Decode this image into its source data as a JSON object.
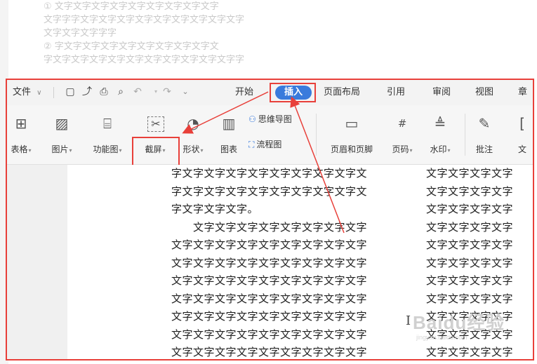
{
  "background_doc": {
    "lines": [
      "① 文字文字文字文字文字文字文字文字文字",
      "文字字字文字文字文字文字文字文字文字文字文字",
      "文字文字文字字字",
      "② 字文字文字文字文字文字文字文字文字文",
      "字文字文字文字文字文字文字文字文字文字文字字"
    ]
  },
  "menubar": {
    "file": "文件",
    "tabs": [
      "开始",
      "插入",
      "页面布局",
      "引用",
      "审阅",
      "视图",
      "章"
    ]
  },
  "ribbon": {
    "table": "表格",
    "picture": "图片",
    "function_chart": "功能图",
    "screenshot": "截屏",
    "shape": "形状",
    "chart": "图表",
    "mindmap": "思维导图",
    "flowchart": "流程图",
    "header_footer": "页眉和页脚",
    "page_number": "页码",
    "watermark": "水印",
    "comment": "批注",
    "text": "文"
  },
  "document": {
    "column1": [
      "字文字文字文字文字文字文字文字文字文",
      "字文字文字文字文字文字文字文字文字文",
      "字文字文字文字。",
      "　　文字文字文字文字文字文字文字文字",
      "文字文字文字文字文字文字文字文字文字",
      "文字文字文字文字文字文字文字文字文字",
      "文字文字文字文字文字文字文字文字文字",
      "文字文字文字文字文字文字文字文字文字",
      "文字文字文字文字文字文字文字文字文字",
      "文字文字文字文字文字文字文字文字文字",
      "文字文字文字文字文字文字文字文字文字"
    ],
    "column2": [
      "文字文字文字文字",
      "文字文字文字文字",
      "文字文字文字文字",
      "文字文字文字文字",
      "文字文字文字文字",
      "文字文字文字文字",
      "文字文字文字文字",
      "文字文字文字文字",
      "文字文字文字文字",
      "文字文字文字文字",
      "文字文字文字文字"
    ]
  },
  "watermark": {
    "brand": "Baidu经验",
    "url": "jingyan.baidu.com"
  },
  "colors": {
    "highlight_red": "#e8403a",
    "active_tab_blue": "#3a7bdc"
  },
  "icons": {
    "save": "save-icon",
    "share": "share-icon",
    "print": "print-icon",
    "preview": "print-preview-icon",
    "undo": "undo-icon",
    "redo": "redo-icon",
    "more": "chevron-down-icon"
  }
}
